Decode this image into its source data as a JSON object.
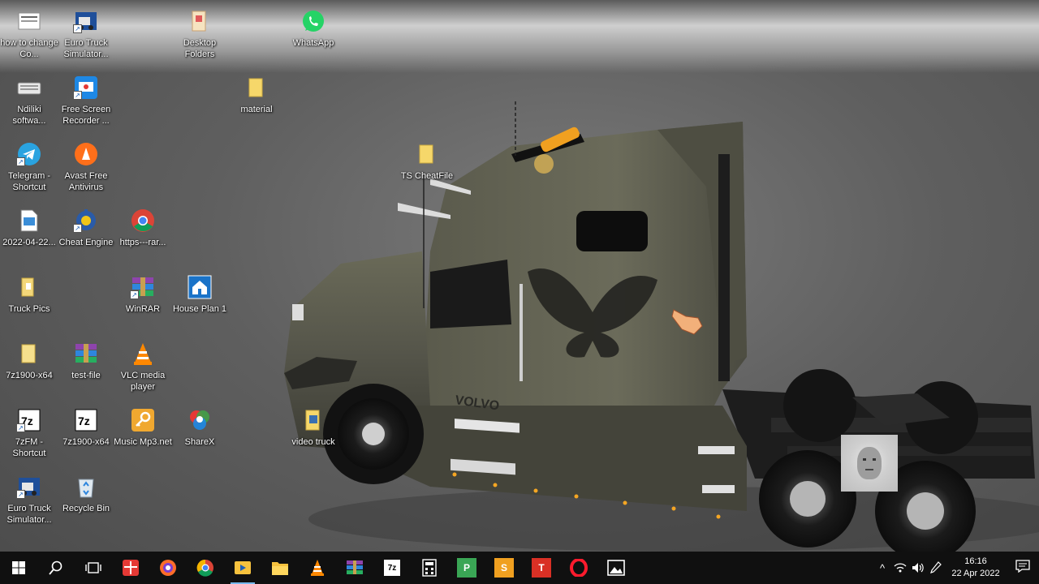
{
  "desktop": {
    "icons": [
      {
        "label": "how to change Co...",
        "icon": "document-icon"
      },
      {
        "label": "Euro Truck Simulator...",
        "icon": "ets2-game-icon"
      },
      {
        "label": "Desktop Folders",
        "icon": "folder-shortcut-icon"
      },
      {
        "label": "WhatsApp",
        "icon": "whatsapp-icon"
      },
      {
        "label": "Ndiliki softwa...",
        "icon": "keyboard-icon"
      },
      {
        "label": "Free Screen Recorder ...",
        "icon": "screen-recorder-icon"
      },
      {
        "label": "material",
        "icon": "folder-icon"
      },
      {
        "label": "Telegram - Shortcut",
        "icon": "telegram-icon"
      },
      {
        "label": "Avast Free Antivirus",
        "icon": "avast-icon"
      },
      {
        "label": "TS CheatFile",
        "icon": "folder-icon"
      },
      {
        "label": "2022-04-22...",
        "icon": "image-file-icon"
      },
      {
        "label": "Cheat Engine",
        "icon": "cheat-engine-icon"
      },
      {
        "label": "https---rar...",
        "icon": "chrome-icon"
      },
      {
        "label": "Truck Pics",
        "icon": "folder-icon"
      },
      {
        "label": "WinRAR",
        "icon": "winrar-icon"
      },
      {
        "label": "House Plan 1",
        "icon": "house-plan-icon"
      },
      {
        "label": "7z1900-x64",
        "icon": "folder-icon"
      },
      {
        "label": "test-file",
        "icon": "rar-archive-icon"
      },
      {
        "label": "VLC media player",
        "icon": "vlc-icon"
      },
      {
        "label": "7zFM - Shortcut",
        "icon": "7zip-icon"
      },
      {
        "label": "7z1900-x64",
        "icon": "7zip-icon"
      },
      {
        "label": "Music Mp3.net",
        "icon": "music-key-icon"
      },
      {
        "label": "ShareX",
        "icon": "sharex-icon"
      },
      {
        "label": "video truck",
        "icon": "video-folder-icon"
      },
      {
        "label": "Euro Truck Simulator...",
        "icon": "ets2-game-icon"
      },
      {
        "label": "Recycle Bin",
        "icon": "recycle-bin-icon"
      }
    ]
  },
  "wallpaper": {
    "truck_brand": "VOLVO"
  },
  "taskbar": {
    "apps": [
      {
        "name": "start",
        "icon": "windows-start-icon"
      },
      {
        "name": "search",
        "icon": "search-icon"
      },
      {
        "name": "task-view",
        "icon": "task-view-icon"
      },
      {
        "name": "gift",
        "icon": "gift-app-icon"
      },
      {
        "name": "brave",
        "icon": "brave-browser-icon"
      },
      {
        "name": "chrome",
        "icon": "chrome-icon"
      },
      {
        "name": "screen-recorder",
        "icon": "screen-recorder-icon"
      },
      {
        "name": "file-explorer",
        "icon": "file-explorer-icon"
      },
      {
        "name": "vlc",
        "icon": "vlc-icon"
      },
      {
        "name": "winrar",
        "icon": "winrar-icon"
      },
      {
        "name": "7zip",
        "icon": "7zip-icon"
      },
      {
        "name": "calculator",
        "icon": "calculator-icon"
      },
      {
        "name": "publisher",
        "icon": "publisher-icon"
      },
      {
        "name": "sheets",
        "icon": "sheets-icon"
      },
      {
        "name": "text-app",
        "icon": "text-app-icon"
      },
      {
        "name": "opera",
        "icon": "opera-icon"
      },
      {
        "name": "photos",
        "icon": "photos-icon"
      }
    ],
    "labels": {
      "p": "P",
      "s": "S",
      "t": "T",
      "sevenzip": "7z"
    },
    "tray": {
      "chevron": "^",
      "time": "16:16",
      "date": "22 Apr 2022"
    }
  }
}
